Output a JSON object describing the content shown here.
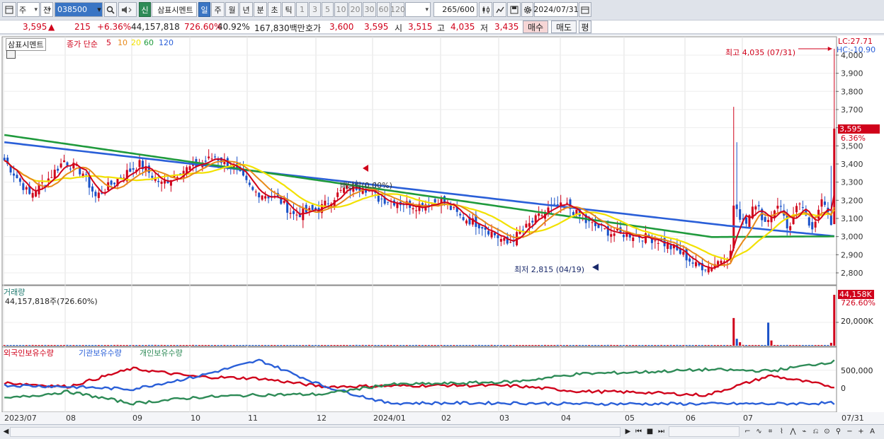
{
  "toolbar": {
    "period_week": "주",
    "prev": "전",
    "code": "038500",
    "stock_name": "삼표시멘트",
    "new_badge": "신",
    "periods": [
      "일",
      "주",
      "월",
      "년",
      "분",
      "초",
      "틱"
    ],
    "counts": [
      "1",
      "3",
      "5",
      "10",
      "20",
      "30",
      "60",
      "120"
    ],
    "bar_count": "265",
    "bar_total": "/600",
    "date": "2024/07/31"
  },
  "quote": {
    "price": "3,595",
    "change_arrow": "▲",
    "change": "215",
    "change_pct": "+6.36%",
    "volume": "44,157,818",
    "volume_pct": "726.60%",
    "turnover_pct": "40.92%",
    "value": "167,830백만",
    "bid_label": "호가",
    "bid": "3,600",
    "ask": "3,595",
    "open_label": "시",
    "open": "3,515",
    "high_label": "고",
    "high": "4,035",
    "low_label": "저",
    "low": "3,435",
    "buy_btn": "매수",
    "sell_btn": "매도",
    "eval_btn": "평"
  },
  "price_panel": {
    "stock_tag": "삼표시멘트",
    "ma_label": "종가 단순",
    "ma_periods": [
      {
        "label": "5",
        "color": "#d0021b"
      },
      {
        "label": "10",
        "color": "#e88a1a"
      },
      {
        "label": "20",
        "color": "#f2e100"
      },
      {
        "label": "60",
        "color": "#1f9a3c"
      },
      {
        "label": "120",
        "color": "#2a5fd8"
      }
    ],
    "lc": "LC:27.71",
    "hc": "HC:-10.90",
    "high_note": "최고 4,035 (07/31)",
    "low_note": "최저 2,815 (04/19)",
    "dividend_note": "배당락(0.00%)",
    "last_price_tag": "3,595",
    "last_pct_tag": "6.36%",
    "y_ticks": [
      "4,000",
      "3,900",
      "3,800",
      "3,700",
      "3,600",
      "3,500",
      "3,400",
      "3,300",
      "3,200",
      "3,100",
      "3,000",
      "2,900",
      "2,800"
    ]
  },
  "volume_panel": {
    "title": "거래량",
    "value_text": "44,157,818주(726.60%)",
    "last_tag": "44,158K",
    "last_pct": "726.60%",
    "y_tick": "20,000K"
  },
  "holding_panel": {
    "series": [
      {
        "name": "외국인보유수량",
        "color": "#d0021b"
      },
      {
        "name": "기관보유수량",
        "color": "#2a5fd8"
      },
      {
        "name": "개인보유수량",
        "color": "#2e8b57"
      }
    ],
    "y_ticks": [
      "500,000",
      "0"
    ]
  },
  "x_axis": [
    "2023/07",
    "08",
    "09",
    "10",
    "11",
    "12",
    "2024/01",
    "02",
    "03",
    "04",
    "05",
    "06",
    "07",
    "07/31"
  ],
  "chart_data": [
    {
      "type": "candlestick",
      "title": "삼표시멘트",
      "ylim": [
        2750,
        4100
      ],
      "x": [
        "2023-07",
        "2023-08",
        "2023-09",
        "2023-10",
        "2023-11",
        "2023-12",
        "2024-01",
        "2024-02",
        "2024-03",
        "2024-04",
        "2024-05",
        "2024-06",
        "2024-07",
        "2024-07-31"
      ],
      "close": [
        3250,
        3340,
        3370,
        3210,
        3130,
        3190,
        3140,
        3020,
        3160,
        3000,
        2850,
        2920,
        3200,
        3595
      ],
      "series": [
        {
          "name": "5",
          "values": [
            3240,
            3350,
            3380,
            3230,
            3140,
            3190,
            3150,
            3010,
            3150,
            3010,
            2870,
            2920,
            3180,
            3210
          ]
        },
        {
          "name": "10",
          "values": [
            3280,
            3340,
            3390,
            3260,
            3150,
            3180,
            3160,
            3020,
            3120,
            3020,
            2890,
            2910,
            3170,
            3160
          ]
        },
        {
          "name": "20",
          "values": [
            3320,
            3330,
            3390,
            3290,
            3170,
            3180,
            3170,
            3040,
            3080,
            3030,
            2920,
            2900,
            3120,
            3140
          ]
        },
        {
          "name": "60",
          "values": [
            3550,
            3460,
            3370,
            3340,
            3280,
            3230,
            3190,
            3120,
            3090,
            3060,
            3020,
            2960,
            3010,
            3080
          ]
        },
        {
          "name": "120",
          "values": [
            3520,
            3490,
            3450,
            3410,
            3350,
            3300,
            3250,
            3200,
            3170,
            3120,
            3080,
            3040,
            3030,
            3040
          ]
        }
      ]
    },
    {
      "type": "bar",
      "title": "거래량",
      "ylabel": "거래량",
      "x": [
        "2024-06-03",
        "2024-06-07",
        "2024-06-24",
        "2024-07-30",
        "2024-07-31"
      ],
      "values": [
        24000,
        6000,
        20000,
        2500,
        44158
      ],
      "unit": "K"
    },
    {
      "type": "line",
      "series": [
        {
          "name": "외국인보유수량",
          "values": [
            150000,
            40000,
            550000,
            320000,
            270000,
            40000,
            60000,
            80000,
            60000,
            -90000,
            -120000,
            -200000,
            350000,
            40000
          ]
        },
        {
          "name": "기관보유수량",
          "values": [
            80000,
            40000,
            -30000,
            320000,
            780000,
            60000,
            -420000,
            -420000,
            -420000,
            -440000,
            -440000,
            -440000,
            -440000,
            -420000
          ]
        },
        {
          "name": "개인보유수량",
          "values": [
            -300000,
            -100000,
            -430000,
            -260000,
            -190000,
            -170000,
            100000,
            130000,
            180000,
            400000,
            450000,
            520000,
            480000,
            750000
          ]
        }
      ],
      "y_ticks": [
        500000,
        0
      ]
    }
  ]
}
